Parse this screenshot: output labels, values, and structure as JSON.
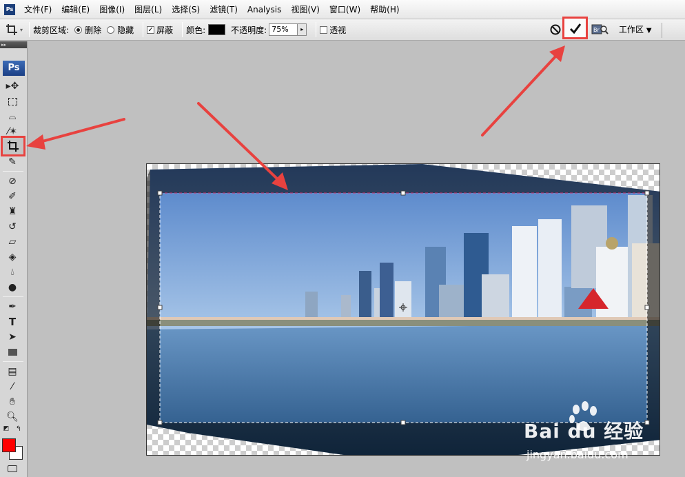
{
  "app": {
    "icon_label": "Ps"
  },
  "menu": [
    "文件(F)",
    "编辑(E)",
    "图像(I)",
    "图层(L)",
    "选择(S)",
    "滤镜(T)",
    "Analysis",
    "视图(V)",
    "窗口(W)",
    "帮助(H)"
  ],
  "options": {
    "crop_area_label": "裁剪区域:",
    "delete_label": "删除",
    "hide_label": "隐藏",
    "shield_label": "屏蔽",
    "color_label": "颜色:",
    "opacity_label": "不透明度:",
    "opacity_value": "75%",
    "perspective_label": "透视",
    "commit_icon": "checkmark-icon",
    "workspace_label": "工作区",
    "delete_selected": true,
    "shield_checked": true,
    "perspective_checked": false,
    "shield_color": "#000000"
  },
  "toolbox": {
    "logo": "Ps",
    "active_tool": "crop-tool"
  },
  "colors": {
    "foreground": "#ff0000",
    "background": "#ffffff",
    "annotation": "#e8423f"
  },
  "watermark": {
    "brand": "Bai du 经验",
    "url": "jingyan.baidu.com"
  }
}
